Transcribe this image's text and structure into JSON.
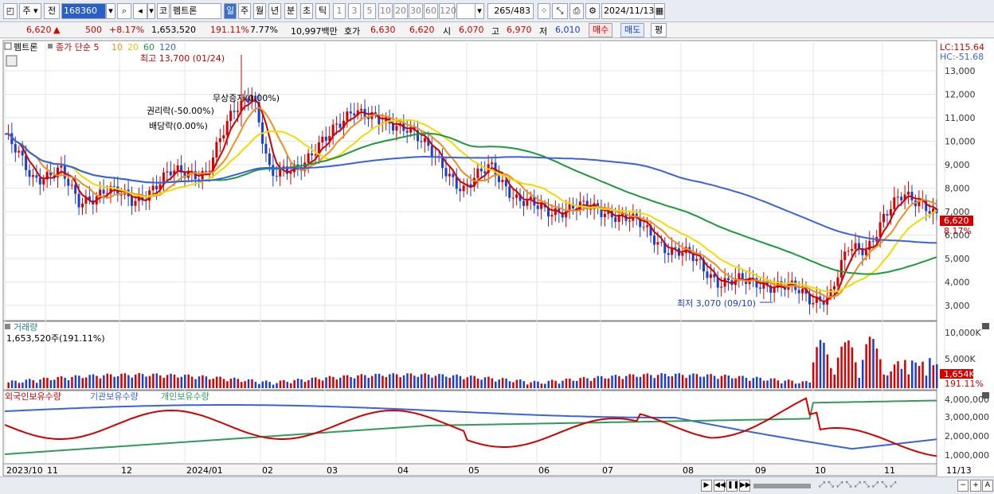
{
  "toolbar": {
    "period_type": "주",
    "prev_label": "전",
    "stock_code": "168360",
    "market_label": "코",
    "stock_name": "펨트론",
    "periods": [
      "일",
      "주",
      "월",
      "년",
      "분",
      "초",
      "틱"
    ],
    "minute_units": [
      "1",
      "3",
      "5",
      "10",
      "20",
      "30",
      "60",
      "120"
    ],
    "count_display": "265",
    "count_total": "/483",
    "date": "2024/11/13"
  },
  "quote": {
    "price": "6,620",
    "change": "500",
    "change_pct": "+8.17%",
    "volume": "1,653,520",
    "volume_ratio": "191.11%",
    "turnover": "7.77%",
    "amount": "10,997백만",
    "bid_label": "호가",
    "ask": "6,630",
    "bid": "6,620",
    "open_label": "시",
    "open": "6,070",
    "high_label": "고",
    "high": "6,970",
    "low_label": "저",
    "low": "6,010",
    "buy_label": "매수",
    "sell_label": "매도",
    "flat_label": "평"
  },
  "price_panel": {
    "legend_name": "펨트론",
    "legend_ma": "종가 단순 5",
    "legend_ma_10": "10",
    "legend_ma_20": "20",
    "legend_ma_60": "60",
    "legend_ma_120": "120",
    "lc": "LC:115.64",
    "hc": "HC:-51.68",
    "high_note": "최고 13,700 (01/24)",
    "low_note": "최저 3,070 (09/10)",
    "event_rights": "권리락(-50.00%)",
    "event_dividend": "배당락(0.00%)",
    "event_bonus": "무상증자(0.00%)",
    "current_price_tag": "6,620",
    "current_pct_tag": "8.17%",
    "y_ticks": [
      "13,000",
      "12,000",
      "11,000",
      "10,000",
      "9,000",
      "8,000",
      "7,000",
      "6,000",
      "5,000",
      "4,000",
      "3,000"
    ]
  },
  "volume_panel": {
    "title": "거래량",
    "value": "1,653,520주(191.11%)",
    "y_ticks": [
      "10,000K",
      "5,000K"
    ],
    "current_tag": "1,654K",
    "current_pct": "191.11%"
  },
  "holding_panel": {
    "legend_foreign": "외국인보유수량",
    "legend_inst": "기관보유수량",
    "legend_indiv": "개인보유수량",
    "y_ticks": [
      "4,000,000",
      "3,000,000",
      "2,000,000",
      "1,000,000"
    ]
  },
  "x_axis": {
    "labels": [
      "2023/10",
      "11",
      "12",
      "2024/01",
      "02",
      "03",
      "04",
      "05",
      "06",
      "07",
      "08",
      "09",
      "10",
      "11",
      "11/13"
    ]
  },
  "colors": {
    "up": "#d40000",
    "down": "#1a3fd0",
    "ma5": "#d40000",
    "ma10": "#f0901c",
    "ma20": "#f2dc00",
    "ma60": "#1c9a3c",
    "ma120": "#3a62e0",
    "foreign": "#d40000",
    "inst": "#3a62e0",
    "indiv": "#2f9c5a"
  }
}
